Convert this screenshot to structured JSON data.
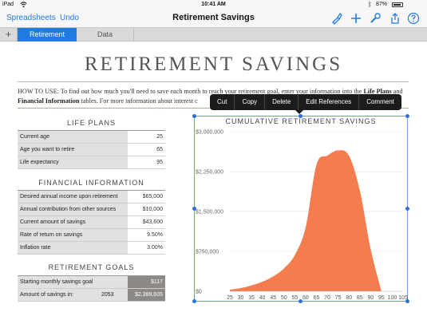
{
  "status": {
    "device": "iPad",
    "time": "10:41 AM",
    "battery": "87%"
  },
  "toolbar": {
    "back_label": "Spreadsheets",
    "undo_label": "Undo",
    "title": "Retirement Savings"
  },
  "tabs": [
    {
      "label": "Retirement",
      "active": true
    },
    {
      "label": "Data",
      "active": false
    }
  ],
  "doc": {
    "title": "RETIREMENT SAVINGS",
    "howto_lead": "HOW TO USE:",
    "howto_text": " To find out how much you'll need to save each month to reach your retirement goal, enter your information into the ",
    "howto_bold1": "Life Plans",
    "howto_and": " and ",
    "howto_bold2": "Financial Information",
    "howto_tail": " tables. For more information about interest c"
  },
  "life_plans": {
    "title": "LIFE PLANS",
    "rows": [
      {
        "label": "Current age",
        "value": "25"
      },
      {
        "label": "Age you want to retire",
        "value": "65"
      },
      {
        "label": "Life expectancy",
        "value": "95"
      }
    ]
  },
  "financial_info": {
    "title": "FINANCIAL INFORMATION",
    "rows": [
      {
        "label": "Desired annual income upon retirement",
        "value": "$65,000"
      },
      {
        "label": "Annual contribution from other sources",
        "value": "$10,000"
      },
      {
        "label": "Current amount of savings",
        "value": "$43,600"
      },
      {
        "label": "Rate of return on savings",
        "value": "9.50%"
      },
      {
        "label": "Inflation rate",
        "value": "3.00%"
      }
    ]
  },
  "retirement_goals": {
    "title": "RETIREMENT GOALS",
    "rows": [
      {
        "label": "Starting monthly savings goal",
        "year": "",
        "value": "$117"
      },
      {
        "label": "Amount of savings in:",
        "year": "2053",
        "value": "$2,389,605"
      }
    ]
  },
  "popup_menu": [
    "Cut",
    "Copy",
    "Delete",
    "Edit References",
    "Comment"
  ],
  "icons": [
    "wifi-icon",
    "bluetooth-icon",
    "format-brush-icon",
    "add-icon",
    "wrench-icon",
    "share-icon",
    "help-icon"
  ],
  "colors": {
    "accent": "#1f7be0",
    "chart_fill": "#f47c4f",
    "selection": "#2f6fdc"
  },
  "chart_data": {
    "type": "area",
    "title": "CUMULATIVE RETIREMENT SAVINGS",
    "x": [
      25,
      30,
      35,
      40,
      45,
      50,
      55,
      60,
      65,
      70,
      75,
      80,
      85,
      90,
      95
    ],
    "values": [
      30000,
      60000,
      110000,
      180000,
      280000,
      430000,
      680000,
      1200000,
      2380000,
      2550000,
      2650000,
      2550000,
      1900000,
      800000,
      0
    ],
    "xticks": [
      "25",
      "30",
      "35",
      "40",
      "45",
      "50",
      "55",
      "60",
      "65",
      "70",
      "75",
      "80",
      "85",
      "90",
      "95",
      "100",
      "105"
    ],
    "yticks": [
      "$0",
      "$750,000",
      "$1,500,000",
      "$2,250,000",
      "$3,000,000"
    ],
    "ylim": [
      0,
      3000000
    ],
    "xlim": [
      25,
      105
    ],
    "grid": true,
    "legend": "none"
  }
}
